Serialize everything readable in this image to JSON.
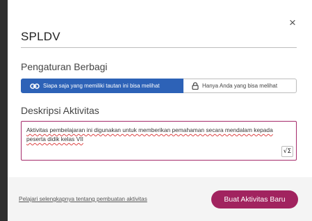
{
  "modal": {
    "title": "SPLDV",
    "close_glyph": "×",
    "sharing": {
      "heading": "Pengaturan Berbagi",
      "options": [
        {
          "label": "Siapa saja yang memiliki tautan ini bisa melihat",
          "icon": "link-icon",
          "selected": true
        },
        {
          "label": "Hanya Anda yang bisa melihat",
          "icon": "lock-icon",
          "selected": false
        }
      ]
    },
    "description": {
      "heading": "Deskripsi Aktivitas",
      "value": "Aktivitas pembelajaran ini digunakan untuk memberikan pemahaman secara mendalam kepada peserta didik kelas VII",
      "math_button_label": "√Σ"
    },
    "footer": {
      "learn_more_link": "Pelajari selengkapnya tentang pembuatan aktivitas",
      "create_button": "Buat Aktivitas Baru"
    }
  },
  "colors": {
    "primary": "#a1235f",
    "share_selected": "#2d62b7",
    "footer_bg": "#f4f4f4"
  }
}
